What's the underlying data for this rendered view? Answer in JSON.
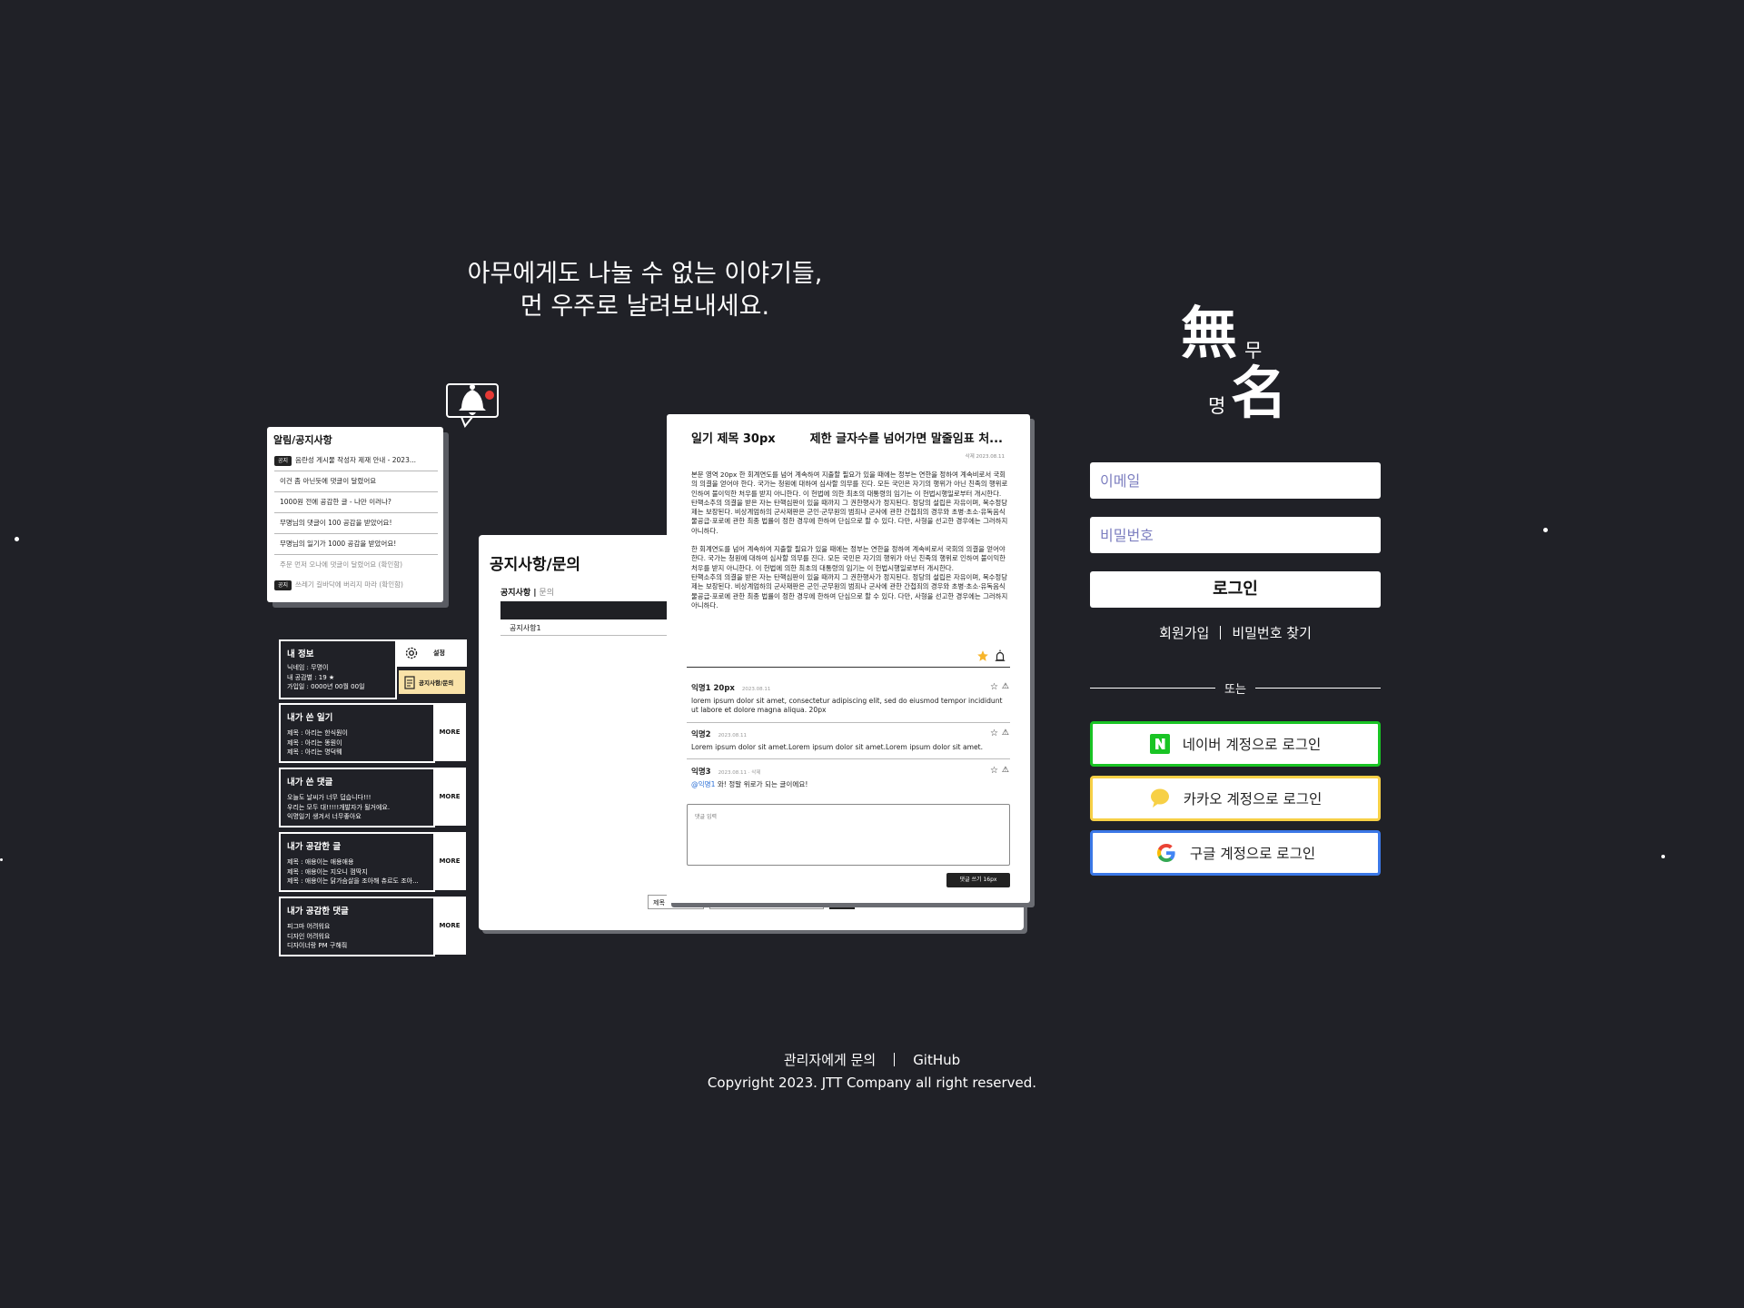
{
  "tagline": {
    "line1": "아무에게도 나눌 수 없는 이야기들,",
    "line2": "먼 우주로 날려보내세요."
  },
  "notice_card": {
    "title": "알림/공지사항",
    "items": [
      {
        "tag": "공지",
        "text": "음란성 게시물 작성자 제재 안내 - 2023..."
      },
      {
        "tag": "",
        "text": "이건 좀 아닌듯에 댓글이 달렸어요"
      },
      {
        "tag": "",
        "text": "1000원 전에 공감한 글 - 나만 이러나?"
      },
      {
        "tag": "",
        "text": "무명님의 댓글이 100 공감을 받았어요!"
      },
      {
        "tag": "",
        "text": "무명님의 일기가 1000 공감을 받았어요!"
      },
      {
        "tag": "",
        "text": "주문 먼저 오나에 댓글이 달렸어요 (확인함)"
      },
      {
        "tag": "공지",
        "text": "쓰레기 길바닥에 버리지 마라 (확인함)"
      }
    ]
  },
  "dashboard": {
    "my_info": {
      "title": "내 정보",
      "lines": [
        "닉네임 : 무명이",
        "내 공감별 : 19 ★",
        "가입일 : 0000년 00월 00일"
      ]
    },
    "settings_label": "설정",
    "notice_label": "공지사항/문의",
    "my_diaries": {
      "title": "내가 쓴 일기",
      "lines": [
        "제목 : 아리는 한식뭔이",
        "제목 : 아리는 똥뭔이",
        "제목 : 아리는 명덕뭬"
      ],
      "more": "MORE"
    },
    "my_comments": {
      "title": "내가 쓴 댓글",
      "lines": [
        "오늘도 날씨가 너무 덥습니다!!!",
        "우리는 모두 대!!!!!개발자가 될거에요.",
        "익명일기 생겨서 너무좋아요"
      ],
      "more": "MORE"
    },
    "liked_posts": {
      "title": "내가 공감한 글",
      "lines": [
        "제목 : 애용이는 애용애용",
        "제목 : 애용이는 지오니 껌딱지",
        "제목 : 애용이는 닭가슴살을 조아해 츄르도 조아..."
      ],
      "more": "MORE"
    },
    "liked_comments": {
      "title": "내가 공감한 댓글",
      "lines": [
        "피그마 어려워요",
        "디자인 어려워요",
        "디자이너랑 PM 구해줘"
      ],
      "more": "MORE"
    }
  },
  "inquiry_panel": {
    "title": "공지사항/문의",
    "tab_active": "공지사항 |",
    "tab_inactive": " 문의",
    "row1": "공지사항1",
    "select_label": "제목",
    "search_label": "검색"
  },
  "diary": {
    "title": "일기 제목 30px",
    "title_overflow": "제한 글자수를 넘어가면 말줄임표 처...",
    "meta": "삭제   2023.08.11",
    "paragraphs": [
      "본문 영역 20px 한 회계연도를 넘어 계속하여 지출할 필요가 있을 때에는 정부는 연한을 정하여 계속비로서 국회의 의결을 얻어야 한다. 국가는 청원에 대하여 심사할 의무를 진다. 모든 국민은 자기의 행위가 아닌 친족의 행위로 인하여 불이익한 처우를 받지 아니한다. 이 헌법에 의한 최초의 대통령의 임기는 이 헌법시행일로부터 개시한다.\n탄핵소추의 의결을 받은 자는 탄핵심판이 있을 때까지 그 권한행사가 정지된다. 정당의 설립은 자유이며, 복수정당제는 보장된다. 비상계엄하의 군사재판은 군인·군무원의 범죄나 군사에 관한 간첩죄의 경우와 초병·초소·유독음식물공급·포로에 관한 최종 법률이 정한 경우에 한하여 단심으로 할 수 있다. 다만, 사형을 선고한 경우에는 그러하지 아니하다.",
      "한 회계연도를 넘어 계속하여 지출할 필요가 있을 때에는 정부는 연한을 정하여 계속비로서 국회의 의결을 얻어야 한다. 국가는 청원에 대하여 심사할 의무를 진다. 모든 국민은 자기의 행위가 아닌 친족의 행위로 인하여 불이익한 처우를 받지 아니한다. 이 헌법에 의한 최초의 대통령의 임기는 이 헌법시행일로부터 개시한다.\n탄핵소추의 의결을 받은 자는 탄핵심판이 있을 때까지 그 권한행사가 정지된다. 정당의 설립은 자유이며, 복수정당제는 보장된다. 비상계엄하의 군사재판은 군인·군무원의 범죄나 군사에 관한 간첩죄의 경우와 초병·초소·유독음식물공급·포로에 관한 최종 법률이 정한 경우에 한하여 단심으로 할 수 있다. 다만, 사형을 선고한 경우에는 그러하지 아니하다."
    ],
    "comments": [
      {
        "name": "익명1 20px",
        "date": "2023.08.11",
        "text": "lorem ipsum dolor sit amet, consectetur adipiscing elit, sed do eiusmod tempor incididunt ut labore et dolore magna aliqua. 20px"
      },
      {
        "name": "익명2",
        "date": "2023.08.11",
        "text": "Lorem ipsum dolor sit amet.Lorem ipsum dolor sit amet.Lorem ipsum dolor sit amet."
      },
      {
        "name": "익명3",
        "date": "2023.08.11 · 삭제",
        "mention": "@익명1",
        "text": " 와! 정말 위로가 되는 글이에요!"
      }
    ],
    "comment_placeholder": "댓글 입력",
    "comment_submit": "댓글 쓰기 16px"
  },
  "logo": {
    "char1": "無",
    "char2": "名",
    "reading1": "무",
    "reading2": "명"
  },
  "login": {
    "email_placeholder": "이메일",
    "password_placeholder": "비밀번호",
    "login_button": "로그인",
    "signup_link": "회원가입",
    "find_password_link": "비밀번호 찾기",
    "or_label": "또는",
    "naver_label": "네이버 계정으로 로그인",
    "kakao_label": "카카오 계정으로 로그인",
    "google_label": "구글 계정으로 로그인",
    "naver_color": "#19c424",
    "kakao_color": "#f7d046",
    "google_color": "#3b78e7"
  },
  "footer": {
    "contact_link": "관리자에게 문의",
    "github_link": "GitHub",
    "copyright": "Copyright 2023. JTT Company all right reserved."
  },
  "colors": {
    "background": "#202127",
    "accent_yellow": "#f7b52b",
    "bell_dot": "#e53935"
  }
}
